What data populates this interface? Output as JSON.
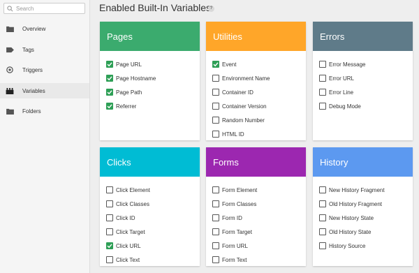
{
  "sidebar": {
    "search_placeholder": "Search",
    "items": [
      {
        "label": "Overview",
        "icon": "folder-icon"
      },
      {
        "label": "Tags",
        "icon": "tag-icon"
      },
      {
        "label": "Triggers",
        "icon": "target-icon"
      },
      {
        "label": "Variables",
        "icon": "blocks-icon",
        "active": true
      },
      {
        "label": "Folders",
        "icon": "folder-icon"
      }
    ]
  },
  "header": {
    "title": "Enabled Built-In Variables",
    "help": "?"
  },
  "colors": {
    "pages": "#3bab6e",
    "utilities": "#ffa629",
    "errors": "#5f7b89",
    "clicks": "#00bcd4",
    "forms": "#9c27b0",
    "history": "#5c99f0",
    "checkbox_checked": "#2e9f56"
  },
  "cards": [
    {
      "title": "Pages",
      "items": [
        {
          "label": "Page URL",
          "checked": true
        },
        {
          "label": "Page Hostname",
          "checked": true
        },
        {
          "label": "Page Path",
          "checked": true
        },
        {
          "label": "Referrer",
          "checked": true
        }
      ]
    },
    {
      "title": "Utilities",
      "items": [
        {
          "label": "Event",
          "checked": true
        },
        {
          "label": "Environment Name",
          "checked": false
        },
        {
          "label": "Container ID",
          "checked": false
        },
        {
          "label": "Container Version",
          "checked": false
        },
        {
          "label": "Random Number",
          "checked": false
        },
        {
          "label": "HTML ID",
          "checked": false
        }
      ]
    },
    {
      "title": "Errors",
      "items": [
        {
          "label": "Error Message",
          "checked": false
        },
        {
          "label": "Error URL",
          "checked": false
        },
        {
          "label": "Error Line",
          "checked": false
        },
        {
          "label": "Debug Mode",
          "checked": false
        }
      ]
    },
    {
      "title": "Clicks",
      "items": [
        {
          "label": "Click Element",
          "checked": false
        },
        {
          "label": "Click Classes",
          "checked": false
        },
        {
          "label": "Click ID",
          "checked": false
        },
        {
          "label": "Click Target",
          "checked": false
        },
        {
          "label": "Click URL",
          "checked": true
        },
        {
          "label": "Click Text",
          "checked": false
        }
      ]
    },
    {
      "title": "Forms",
      "items": [
        {
          "label": "Form Element",
          "checked": false
        },
        {
          "label": "Form Classes",
          "checked": false
        },
        {
          "label": "Form ID",
          "checked": false
        },
        {
          "label": "Form Target",
          "checked": false
        },
        {
          "label": "Form URL",
          "checked": false
        },
        {
          "label": "Form Text",
          "checked": false
        }
      ]
    },
    {
      "title": "History",
      "items": [
        {
          "label": "New History Fragment",
          "checked": false
        },
        {
          "label": "Old History Fragment",
          "checked": false
        },
        {
          "label": "New History State",
          "checked": false
        },
        {
          "label": "Old History State",
          "checked": false
        },
        {
          "label": "History Source",
          "checked": false
        }
      ]
    }
  ]
}
